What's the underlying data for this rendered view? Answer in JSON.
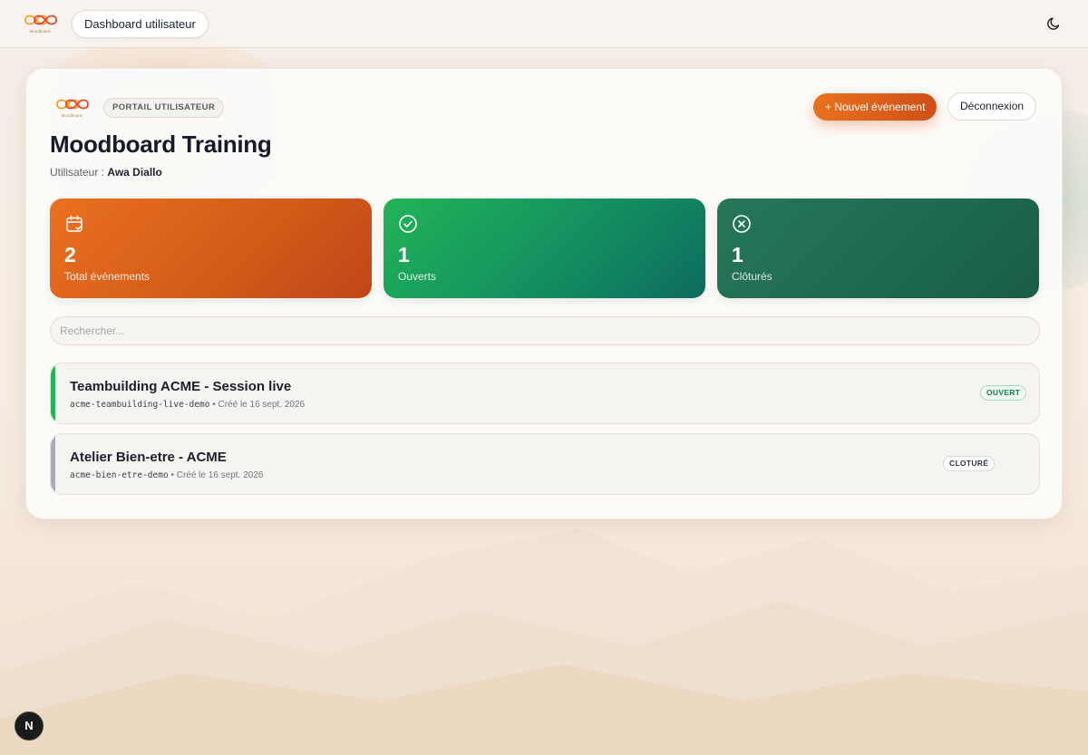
{
  "topbar": {
    "logo_caption": "Moodboard",
    "dashboard_label": "Dashboard utilisateur"
  },
  "header": {
    "logo_caption": "Moodboard",
    "portal_badge": "PORTAIL UTILISATEUR",
    "title": "Moodboard Training",
    "user_prefix": "Utilisateur :",
    "user_name": "Awa Diallo",
    "new_event_label": "+ Nouvel événement",
    "logout_label": "Déconnexion"
  },
  "stats": [
    {
      "icon": "calendar-check-icon",
      "value": "2",
      "label": "Total événements",
      "color": "#e9711f"
    },
    {
      "icon": "check-circle-icon",
      "value": "1",
      "label": "Ouverts",
      "color": "#22b457"
    },
    {
      "icon": "x-circle-icon",
      "value": "1",
      "label": "Clôturés",
      "color": "#1e6a51"
    }
  ],
  "search": {
    "placeholder": "Rechercher..."
  },
  "events": [
    {
      "name": "Teambuilding ACME - Session live",
      "slug": "acme-teambuilding-live-demo",
      "created": "• Créé le 16 sept. 2026",
      "status": "OUVERT",
      "accent": "#22b457"
    },
    {
      "name": "Atelier Bien-etre - ACME",
      "slug": "acme-bien-etre-demo",
      "created": "• Créé le 16 sept. 2026",
      "status": "CLOTURÉ",
      "accent": "#a7acb8"
    }
  ],
  "dev_badge": "N"
}
